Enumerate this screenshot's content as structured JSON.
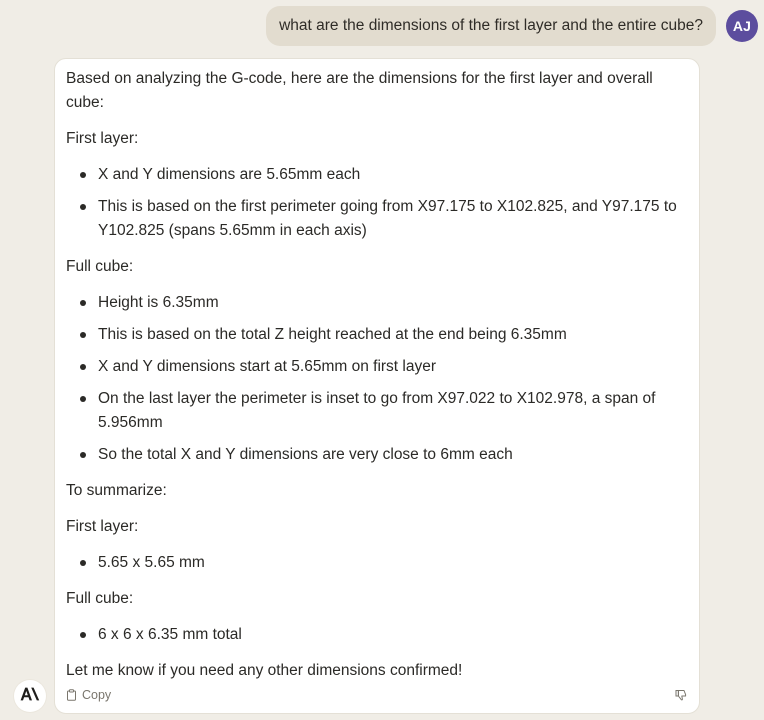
{
  "user_message": {
    "text": "what are the dimensions of the first layer and the entire cube?",
    "avatar_initials": "AJ",
    "avatar_color": "#5c4d9e"
  },
  "assistant_message": {
    "intro": "Based on analyzing the G-code, here are the dimensions for the first layer and overall cube:",
    "first_layer_label": "First layer:",
    "first_layer_points": [
      "X and Y dimensions are 5.65mm each",
      "This is based on the first perimeter going from X97.175 to X102.825, and Y97.175 to Y102.825 (spans 5.65mm in each axis)"
    ],
    "full_cube_label": "Full cube:",
    "full_cube_points": [
      "Height is 6.35mm",
      "This is based on the total Z height reached at the end being 6.35mm",
      "X and Y dimensions start at 5.65mm on first layer",
      "On the last layer the perimeter is inset to go from X97.022 to X102.978, a span of 5.956mm",
      "So the total X and Y dimensions are very close to 6mm each"
    ],
    "summary_label": "To summarize:",
    "summary_first_layer_label": "First layer:",
    "summary_first_layer_points": [
      "5.65 x 5.65 mm"
    ],
    "summary_full_cube_label": "Full cube:",
    "summary_full_cube_points": [
      "6 x 6 x 6.35 mm total"
    ],
    "closing": "Let me know if you need any other dimensions confirmed!"
  },
  "actions": {
    "copy_label": "Copy",
    "copy_icon": "clipboard-icon",
    "feedback_icon": "thumbs-down-icon"
  },
  "assistant_logo": {
    "icon": "anthropic-logo-icon"
  },
  "colors": {
    "page_background": "#f0ede6",
    "user_bubble": "#e2dccf",
    "card_background": "#ffffff"
  }
}
